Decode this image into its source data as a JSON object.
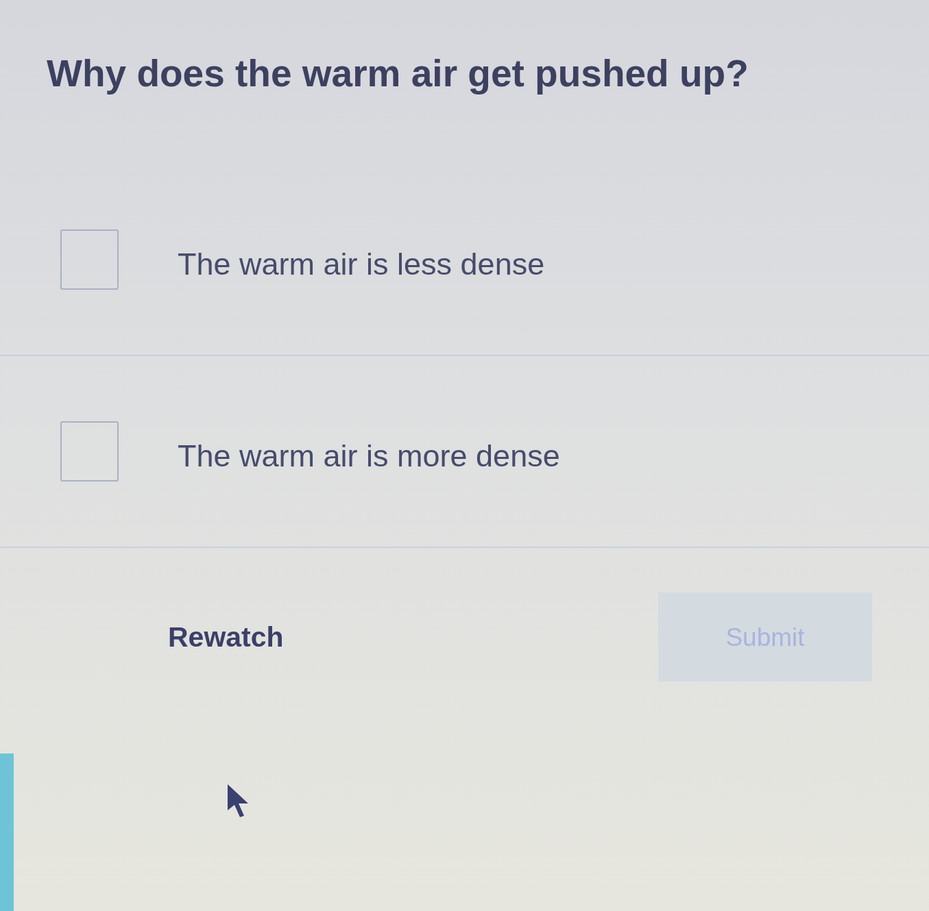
{
  "question": "Why does the warm air get pushed up?",
  "options": [
    {
      "label": "The warm air is less dense",
      "checked": false
    },
    {
      "label": "The warm air is more dense",
      "checked": false
    }
  ],
  "actions": [
    {
      "kind": "link",
      "label": "Rewatch"
    },
    {
      "kind": "button",
      "label": "Submit",
      "disabled": true
    }
  ]
}
